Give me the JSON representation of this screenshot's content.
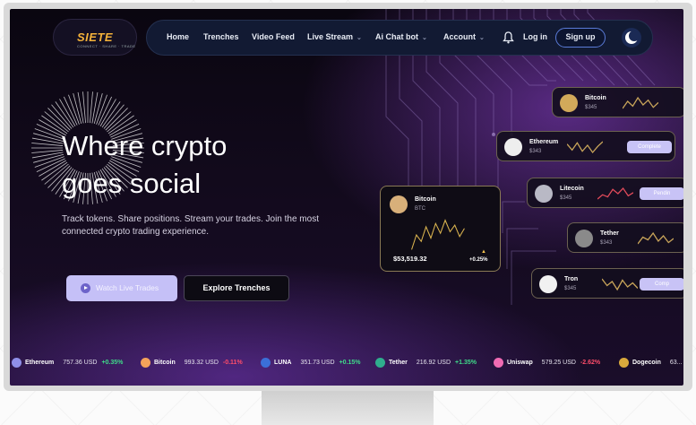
{
  "brand": {
    "name": "SIETE",
    "tagline": "CONNECT · SHARE · TRADE"
  },
  "nav": {
    "items": [
      {
        "label": "Home"
      },
      {
        "label": "Trenches"
      },
      {
        "label": "Video Feed"
      },
      {
        "label": "Live Stream",
        "icon": "chevron-down-icon"
      },
      {
        "label": "Ai Chat bot",
        "icon": "chevron-down-icon"
      },
      {
        "label": "Account",
        "icon": "chevron-down-icon"
      }
    ],
    "bell_icon": "bell-icon",
    "login_label": "Log in",
    "signup_label": "Sign up",
    "theme_icon": "moon-icon"
  },
  "hero": {
    "title_line1": "Where crypto",
    "title_line2": "goes social",
    "subtitle": "Track tokens. Share positions. Stream your trades. Join the most connected crypto trading experience.",
    "primary_button": "Watch Live Trades",
    "secondary_button": "Explore Trenches"
  },
  "feature_card": {
    "name": "Bitcoin",
    "symbol": "BTC",
    "price": "$53,519.32",
    "change": "+0.25%",
    "sparkline": [
      40,
      22,
      30,
      12,
      26,
      8,
      20,
      4,
      18,
      10,
      24,
      14
    ]
  },
  "coin_cards": [
    {
      "name": "Bitcoin",
      "value": "$345",
      "button": "",
      "color": "#d2a95a",
      "trend": "neutral",
      "sparkline": [
        12,
        6,
        10,
        3,
        9,
        5,
        11,
        7
      ]
    },
    {
      "name": "Ethereum",
      "value": "$343",
      "button": "Complete",
      "color": "#eeeeee",
      "trend": "neutral",
      "sparkline": [
        5,
        10,
        4,
        11,
        6,
        12,
        7,
        3
      ]
    },
    {
      "name": "Litecoin",
      "value": "$345",
      "button": "Pendin",
      "color": "#b9b9c5",
      "trend": "down",
      "sparkline": [
        12,
        8,
        10,
        3,
        7,
        2,
        9,
        6
      ]
    },
    {
      "name": "Tether",
      "value": "$343",
      "button": "",
      "color": "#8a8a8a",
      "trend": "neutral",
      "sparkline": [
        12,
        7,
        9,
        4,
        10,
        6,
        11,
        8
      ]
    },
    {
      "name": "Tron",
      "value": "$345",
      "button": "Comp",
      "color": "#f1f1f1",
      "trend": "neutral",
      "sparkline": [
        4,
        9,
        6,
        12,
        5,
        10,
        7,
        11
      ]
    }
  ],
  "ticker": [
    {
      "name": "Ethereum",
      "price": "757.36 USD",
      "change": "+0.35%",
      "dir": "up",
      "color": "#8f8fe8"
    },
    {
      "name": "Bitcoin",
      "price": "993.32 USD",
      "change": "-0.11%",
      "dir": "down",
      "color": "#f4a35a"
    },
    {
      "name": "LUNA",
      "price": "351.73 USD",
      "change": "+0.15%",
      "dir": "up",
      "color": "#3b6fd8"
    },
    {
      "name": "Tether",
      "price": "216.92 USD",
      "change": "+1.35%",
      "dir": "up",
      "color": "#2fae8d"
    },
    {
      "name": "Uniswap",
      "price": "579.25 USD",
      "change": "-2.62%",
      "dir": "down",
      "color": "#f06bb3"
    },
    {
      "name": "Dogecoin",
      "price": "63...",
      "change": "",
      "dir": "up",
      "color": "#d9a93c"
    }
  ]
}
